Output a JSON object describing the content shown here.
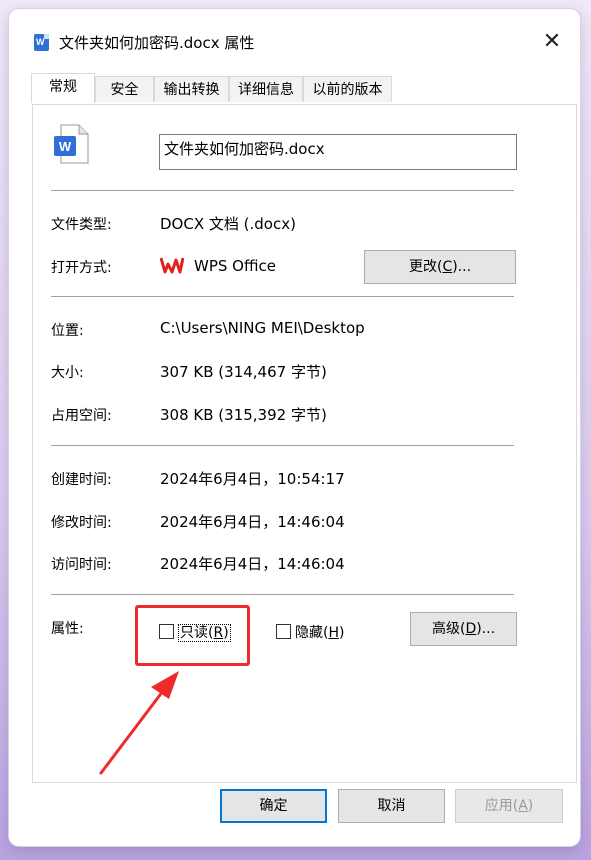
{
  "window": {
    "title": "文件夹如何加密码.docx 属性",
    "close_glyph": "✕"
  },
  "tabs": [
    {
      "label": "常规"
    },
    {
      "label": "安全"
    },
    {
      "label": "输出转换"
    },
    {
      "label": "详细信息"
    },
    {
      "label": "以前的版本"
    }
  ],
  "general": {
    "file_name": "文件夹如何加密码.docx",
    "file_icon_letter": "W",
    "type_label": "文件类型:",
    "type_value": "DOCX 文档 (.docx)",
    "opens_with_label": "打开方式:",
    "opens_with_value": "WPS Office",
    "change_button": {
      "text": "更改(",
      "key": "C",
      "suffix": ")..."
    },
    "location_label": "位置:",
    "location_value": "C:\\Users\\NING MEI\\Desktop",
    "size_label": "大小:",
    "size_value": "307 KB (314,467 字节)",
    "size_on_disk_label": "占用空间:",
    "size_on_disk_value": "308 KB (315,392 字节)",
    "created_label": "创建时间:",
    "created_value": "2024年6月4日，10:54:17",
    "modified_label": "修改时间:",
    "modified_value": "2024年6月4日，14:46:04",
    "accessed_label": "访问时间:",
    "accessed_value": "2024年6月4日，14:46:04",
    "attributes_label": "属性:",
    "readonly": {
      "text": "只读(",
      "key": "R",
      "suffix": ")",
      "checked": false
    },
    "hidden": {
      "text": "隐藏(",
      "key": "H",
      "suffix": ")",
      "checked": false
    },
    "advanced_button": {
      "text": "高级(",
      "key": "D",
      "suffix": ")..."
    }
  },
  "footer": {
    "ok": "确定",
    "cancel": "取消",
    "apply": {
      "text": "应用(",
      "key": "A",
      "suffix": ")",
      "enabled": false
    }
  },
  "colors": {
    "highlight": "#ee2a2a",
    "word_blue": "#2f6fd6",
    "default_button_border": "#0078d4"
  }
}
